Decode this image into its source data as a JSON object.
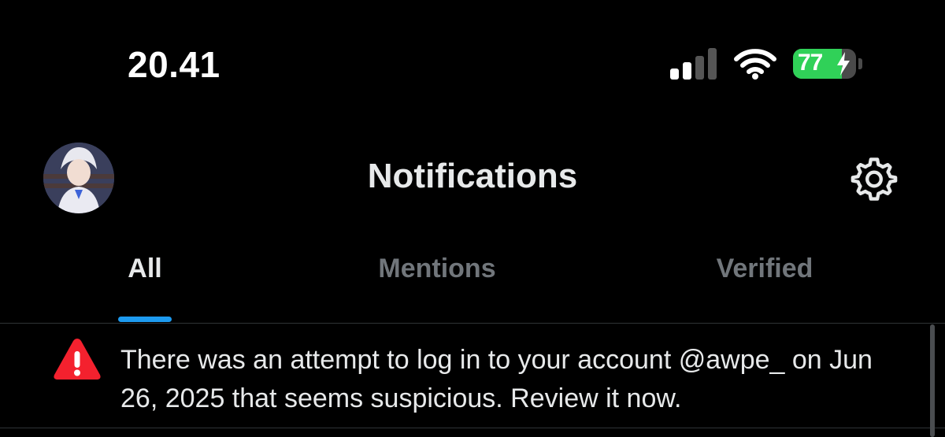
{
  "status_bar": {
    "time": "20.41",
    "battery_percent": "77",
    "battery_level": 0.77,
    "battery_color": "#30d158",
    "signal_bars_active": 2,
    "wifi_icon": "wifi-icon",
    "signal_icon": "cellular-signal-icon",
    "charging_icon": "bolt-icon"
  },
  "header": {
    "title": "Notifications",
    "avatar_icon": "profile-avatar",
    "settings_icon": "gear-icon"
  },
  "tabs": [
    {
      "label": "All",
      "active": true
    },
    {
      "label": "Mentions",
      "active": false
    },
    {
      "label": "Verified",
      "active": false
    }
  ],
  "accent_color": "#1d9bf0",
  "notifications": [
    {
      "icon": "warning-triangle-icon",
      "icon_color": "#f4212e",
      "text": "There was an attempt to log in to your account @awpe_ on Jun 26, 2025 that seems suspicious. Review it now."
    }
  ]
}
